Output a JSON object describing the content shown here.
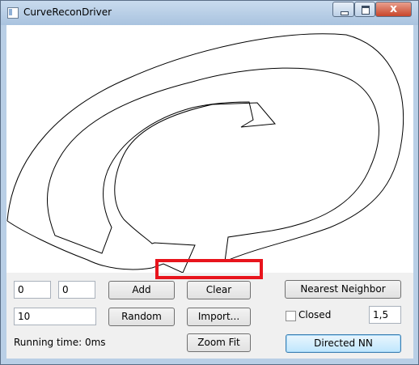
{
  "window": {
    "title": "CurveReconDriver"
  },
  "titlebar": {
    "close_glyph": "x"
  },
  "inputs": {
    "x_value": "0",
    "y_value": "0",
    "count_value": "10",
    "param_value": "1,5"
  },
  "buttons": {
    "add": "Add",
    "clear": "Clear",
    "random": "Random",
    "import": "Import...",
    "zoom_fit": "Zoom Fit",
    "nearest_neighbor": "Nearest Neighbor",
    "directed_nn": "Directed NN"
  },
  "closed_checkbox": {
    "label": "Closed",
    "checked": false
  },
  "status": {
    "running_time": "Running time: 0ms"
  }
}
